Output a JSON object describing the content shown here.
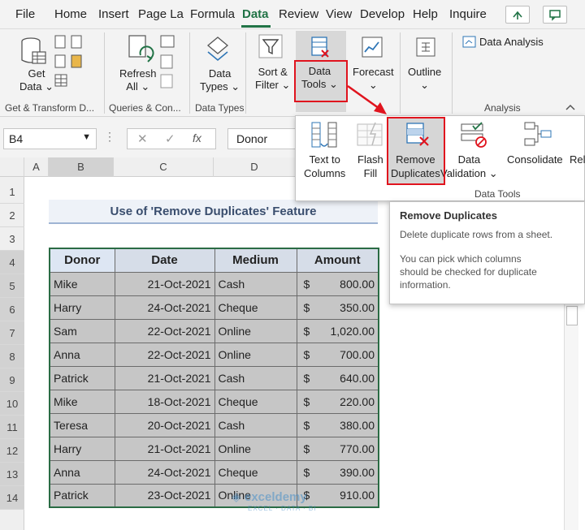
{
  "menu": {
    "tabs": [
      "File",
      "Home",
      "Insert",
      "Page La",
      "Formula",
      "Data",
      "Review",
      "View",
      "Develop",
      "Help",
      "Inquire"
    ],
    "active": "Data"
  },
  "ribbon": {
    "get_data": "Get",
    "get_data2": "Data",
    "refresh": "Refresh",
    "refresh2": "All",
    "data_types": "Data",
    "data_types2": "Types",
    "sort_filter": "Sort &",
    "sort_filter2": "Filter",
    "data_tools": "Data",
    "data_tools2": "Tools",
    "forecast": "Forecast",
    "outline": "Outline",
    "data_analysis": "Data Analysis",
    "groups": {
      "get_transform": "Get & Transform D...",
      "queries": "Queries & Con...",
      "data_types": "Data Types",
      "analysis": "Analysis"
    }
  },
  "formula_bar": {
    "name_box": "B4",
    "fx": "fx",
    "content": "Donor"
  },
  "grid": {
    "columns": [
      "A",
      "B",
      "C",
      "D"
    ],
    "rows": [
      "1",
      "2",
      "3",
      "4",
      "5",
      "6",
      "7",
      "8",
      "9",
      "10",
      "11",
      "12",
      "13",
      "14"
    ],
    "title": "Use of 'Remove Duplicates' Feature",
    "headers": [
      "Donor",
      "Date",
      "Medium",
      "Amount"
    ],
    "currency": "$",
    "records": [
      {
        "donor": "Mike",
        "date": "21-Oct-2021",
        "medium": "Cash",
        "amount": "800.00"
      },
      {
        "donor": "Harry",
        "date": "24-Oct-2021",
        "medium": "Cheque",
        "amount": "350.00"
      },
      {
        "donor": "Sam",
        "date": "22-Oct-2021",
        "medium": "Online",
        "amount": "1,020.00"
      },
      {
        "donor": "Anna",
        "date": "22-Oct-2021",
        "medium": "Online",
        "amount": "700.00"
      },
      {
        "donor": "Patrick",
        "date": "21-Oct-2021",
        "medium": "Cash",
        "amount": "640.00"
      },
      {
        "donor": "Mike",
        "date": "18-Oct-2021",
        "medium": "Cheque",
        "amount": "220.00"
      },
      {
        "donor": "Teresa",
        "date": "20-Oct-2021",
        "medium": "Cash",
        "amount": "380.00"
      },
      {
        "donor": "Harry",
        "date": "21-Oct-2021",
        "medium": "Online",
        "amount": "770.00"
      },
      {
        "donor": "Anna",
        "date": "24-Oct-2021",
        "medium": "Cheque",
        "amount": "390.00"
      },
      {
        "donor": "Patrick",
        "date": "23-Oct-2021",
        "medium": "Online",
        "amount": "910.00"
      }
    ]
  },
  "data_tools_panel": {
    "text_to_columns": "Text to",
    "text_to_columns2": "Columns",
    "flash_fill": "Flash",
    "flash_fill2": "Fill",
    "remove_duplicates": "Remove",
    "remove_duplicates2": "Duplicates",
    "data_validation": "Data",
    "data_validation2": "Validation",
    "consolidate": "Consolidate",
    "relationships": "Rel",
    "group_label": "Data Tools"
  },
  "tooltip": {
    "title": "Remove Duplicates",
    "line1": "Delete duplicate rows from a sheet.",
    "line2": "You can pick which columns",
    "line3": "should be checked for duplicate",
    "line4": "information."
  },
  "watermark": "exceldemy",
  "watermark_sub": "EXCEL · DATA · BI",
  "colors": {
    "excel_green": "#217346",
    "highlight_red": "#e0141e"
  }
}
